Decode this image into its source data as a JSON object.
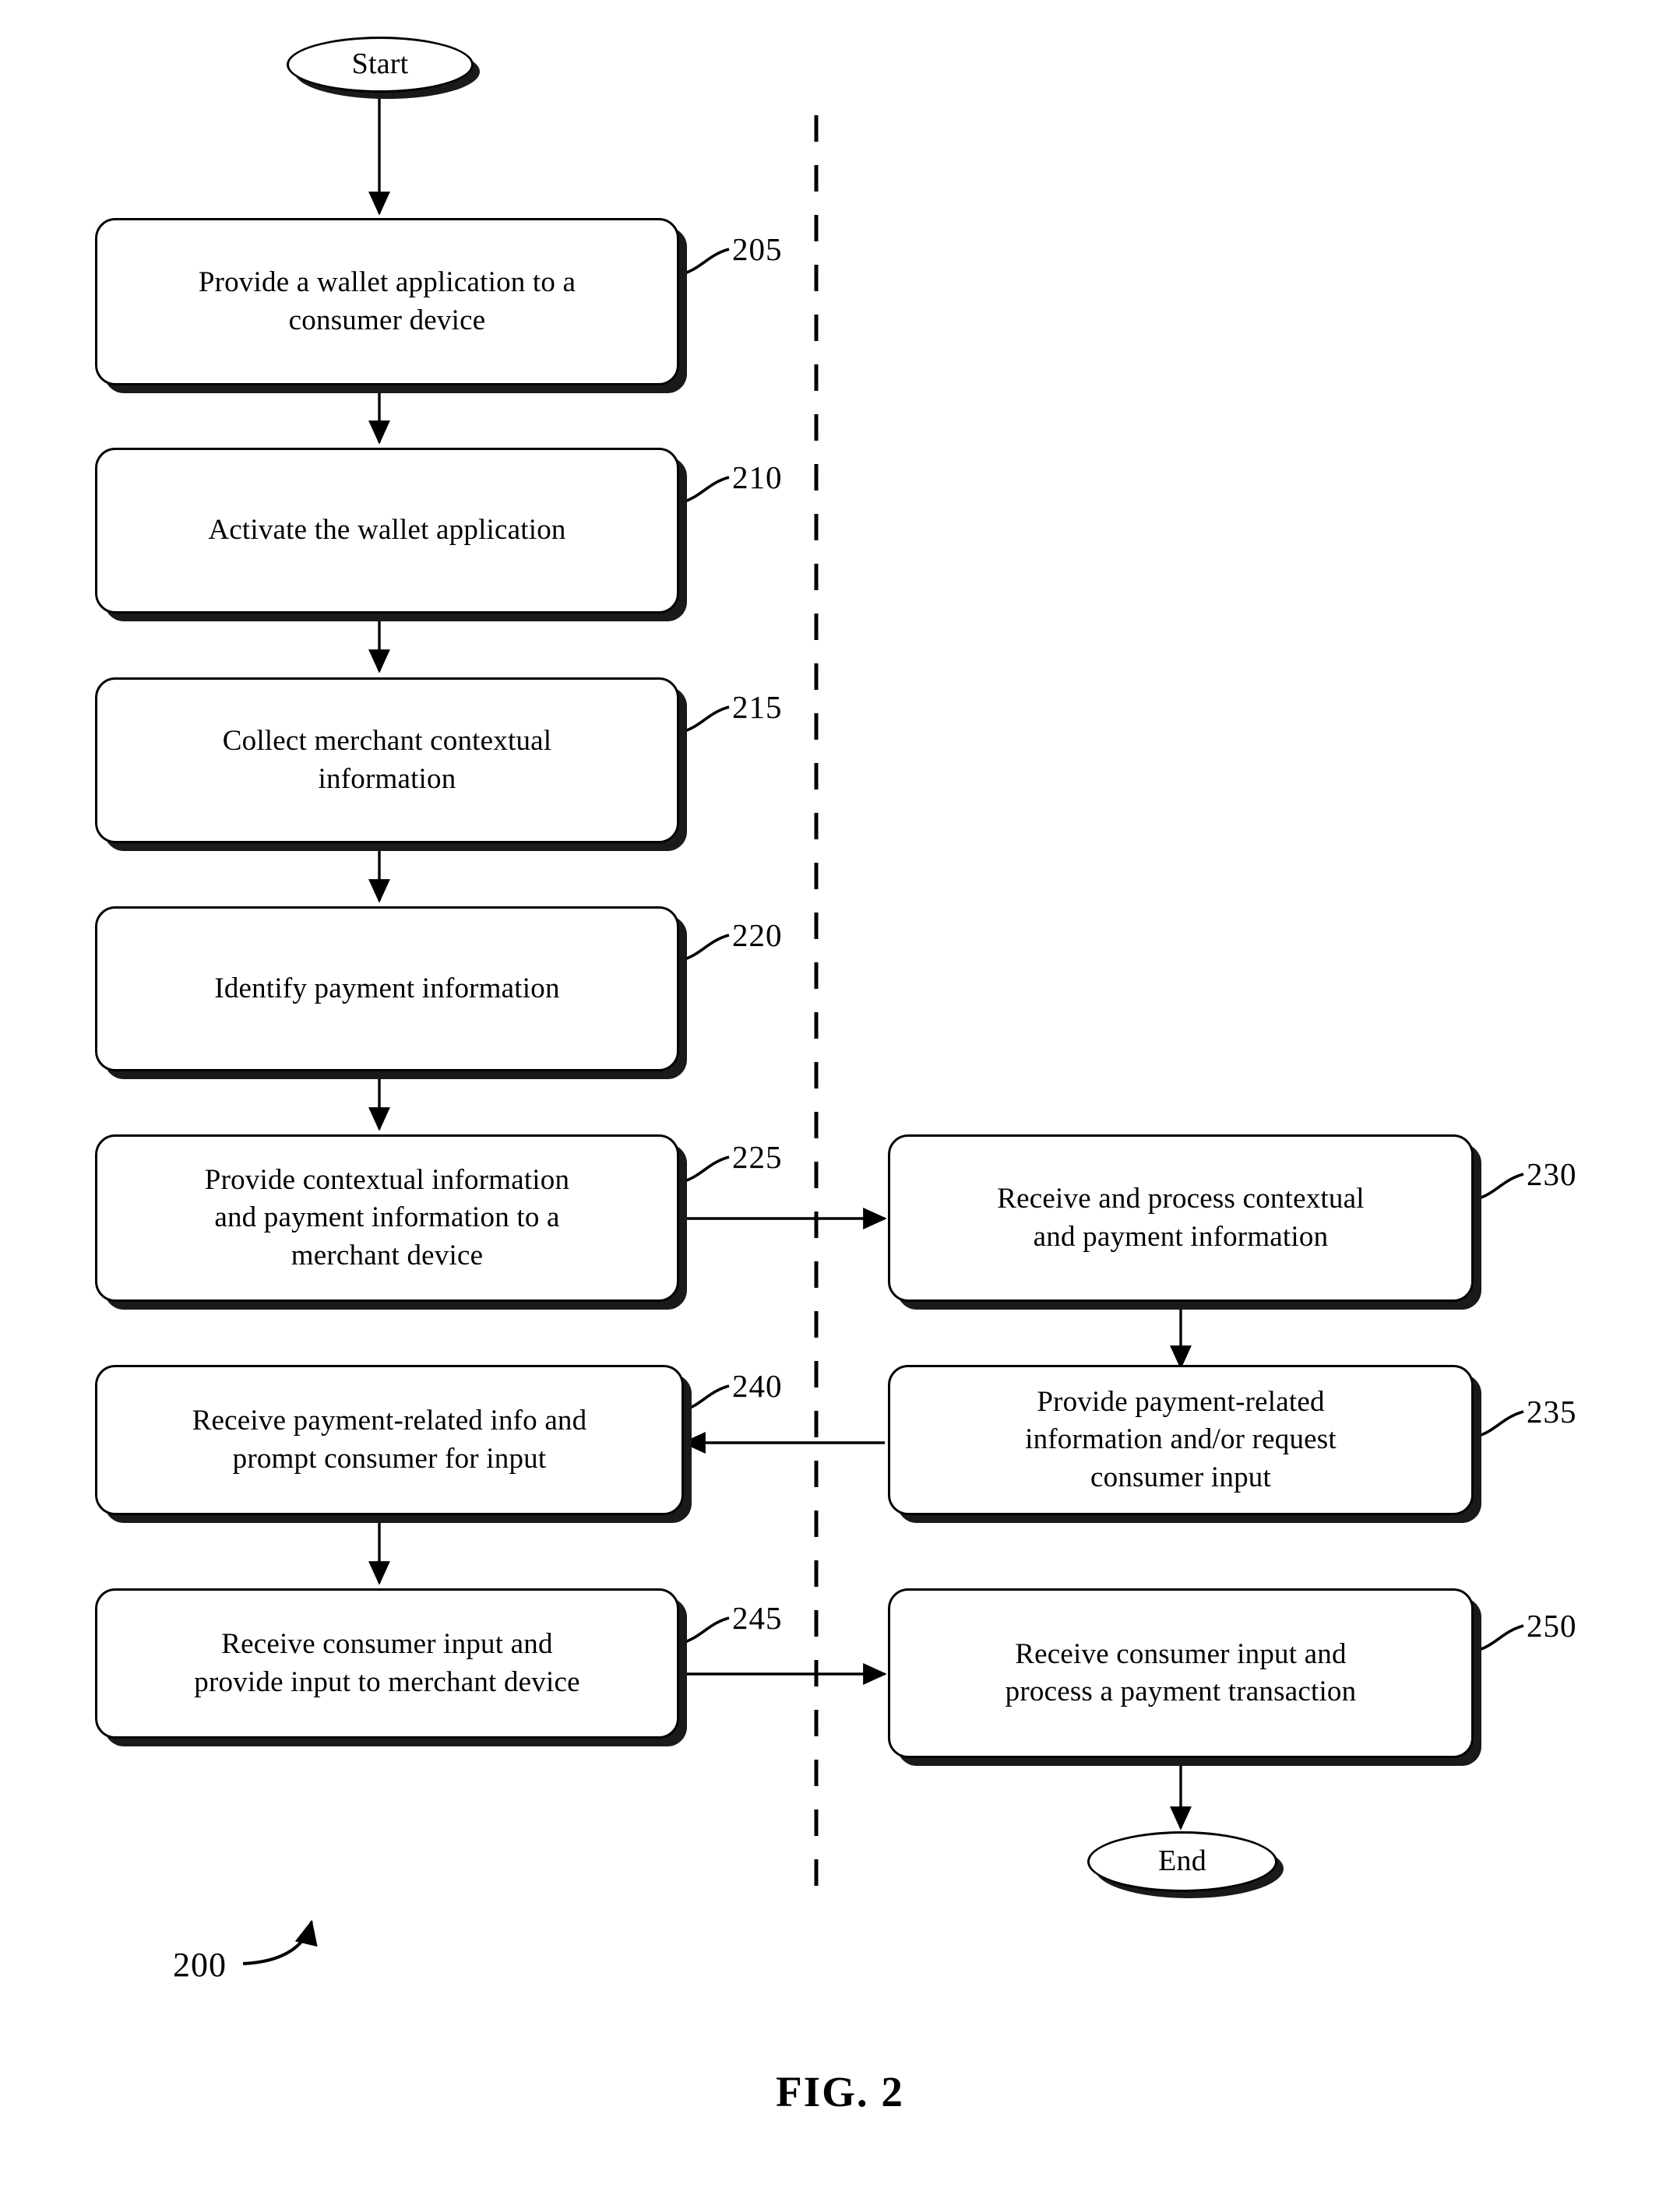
{
  "figure": {
    "caption": "FIG. 2",
    "overall_ref": "200"
  },
  "terminators": {
    "start": {
      "label": "Start",
      "ref": ""
    },
    "end": {
      "label": "End",
      "ref": ""
    }
  },
  "lanes": {
    "consumer_side_label": "",
    "merchant_side_label": "",
    "divider": "dashed-vertical-divider"
  },
  "steps": {
    "s205": {
      "ref": "205",
      "text": "Provide a wallet application to a\nconsumer device"
    },
    "s210": {
      "ref": "210",
      "text": "Activate the wallet application"
    },
    "s215": {
      "ref": "215",
      "text": "Collect merchant contextual\ninformation"
    },
    "s220": {
      "ref": "220",
      "text": "Identify payment information"
    },
    "s225": {
      "ref": "225",
      "text": "Provide contextual information\nand payment information to a\nmerchant device"
    },
    "s230": {
      "ref": "230",
      "text": "Receive and process contextual\nand payment information"
    },
    "s235": {
      "ref": "235",
      "text": "Provide payment-related\ninformation and/or request\nconsumer input"
    },
    "s240": {
      "ref": "240",
      "text": "Receive payment-related info and\nprompt consumer for input"
    },
    "s245": {
      "ref": "245",
      "text": "Receive consumer input and\nprovide input to merchant device"
    },
    "s250": {
      "ref": "250",
      "text": "Receive consumer input and\nprocess a payment transaction"
    }
  },
  "flow_edges": [
    {
      "from": "start",
      "to": "s205",
      "direction": "down"
    },
    {
      "from": "s205",
      "to": "s210",
      "direction": "down"
    },
    {
      "from": "s210",
      "to": "s215",
      "direction": "down"
    },
    {
      "from": "s215",
      "to": "s220",
      "direction": "down"
    },
    {
      "from": "s220",
      "to": "s225",
      "direction": "down"
    },
    {
      "from": "s225",
      "to": "s230",
      "direction": "right"
    },
    {
      "from": "s230",
      "to": "s235",
      "direction": "down"
    },
    {
      "from": "s235",
      "to": "s240",
      "direction": "left"
    },
    {
      "from": "s240",
      "to": "s245",
      "direction": "down"
    },
    {
      "from": "s245",
      "to": "s250",
      "direction": "right"
    },
    {
      "from": "s250",
      "to": "end",
      "direction": "down"
    }
  ],
  "colors": {
    "stroke": "#000000",
    "shadow": "#1a1a1a",
    "background": "#ffffff"
  }
}
